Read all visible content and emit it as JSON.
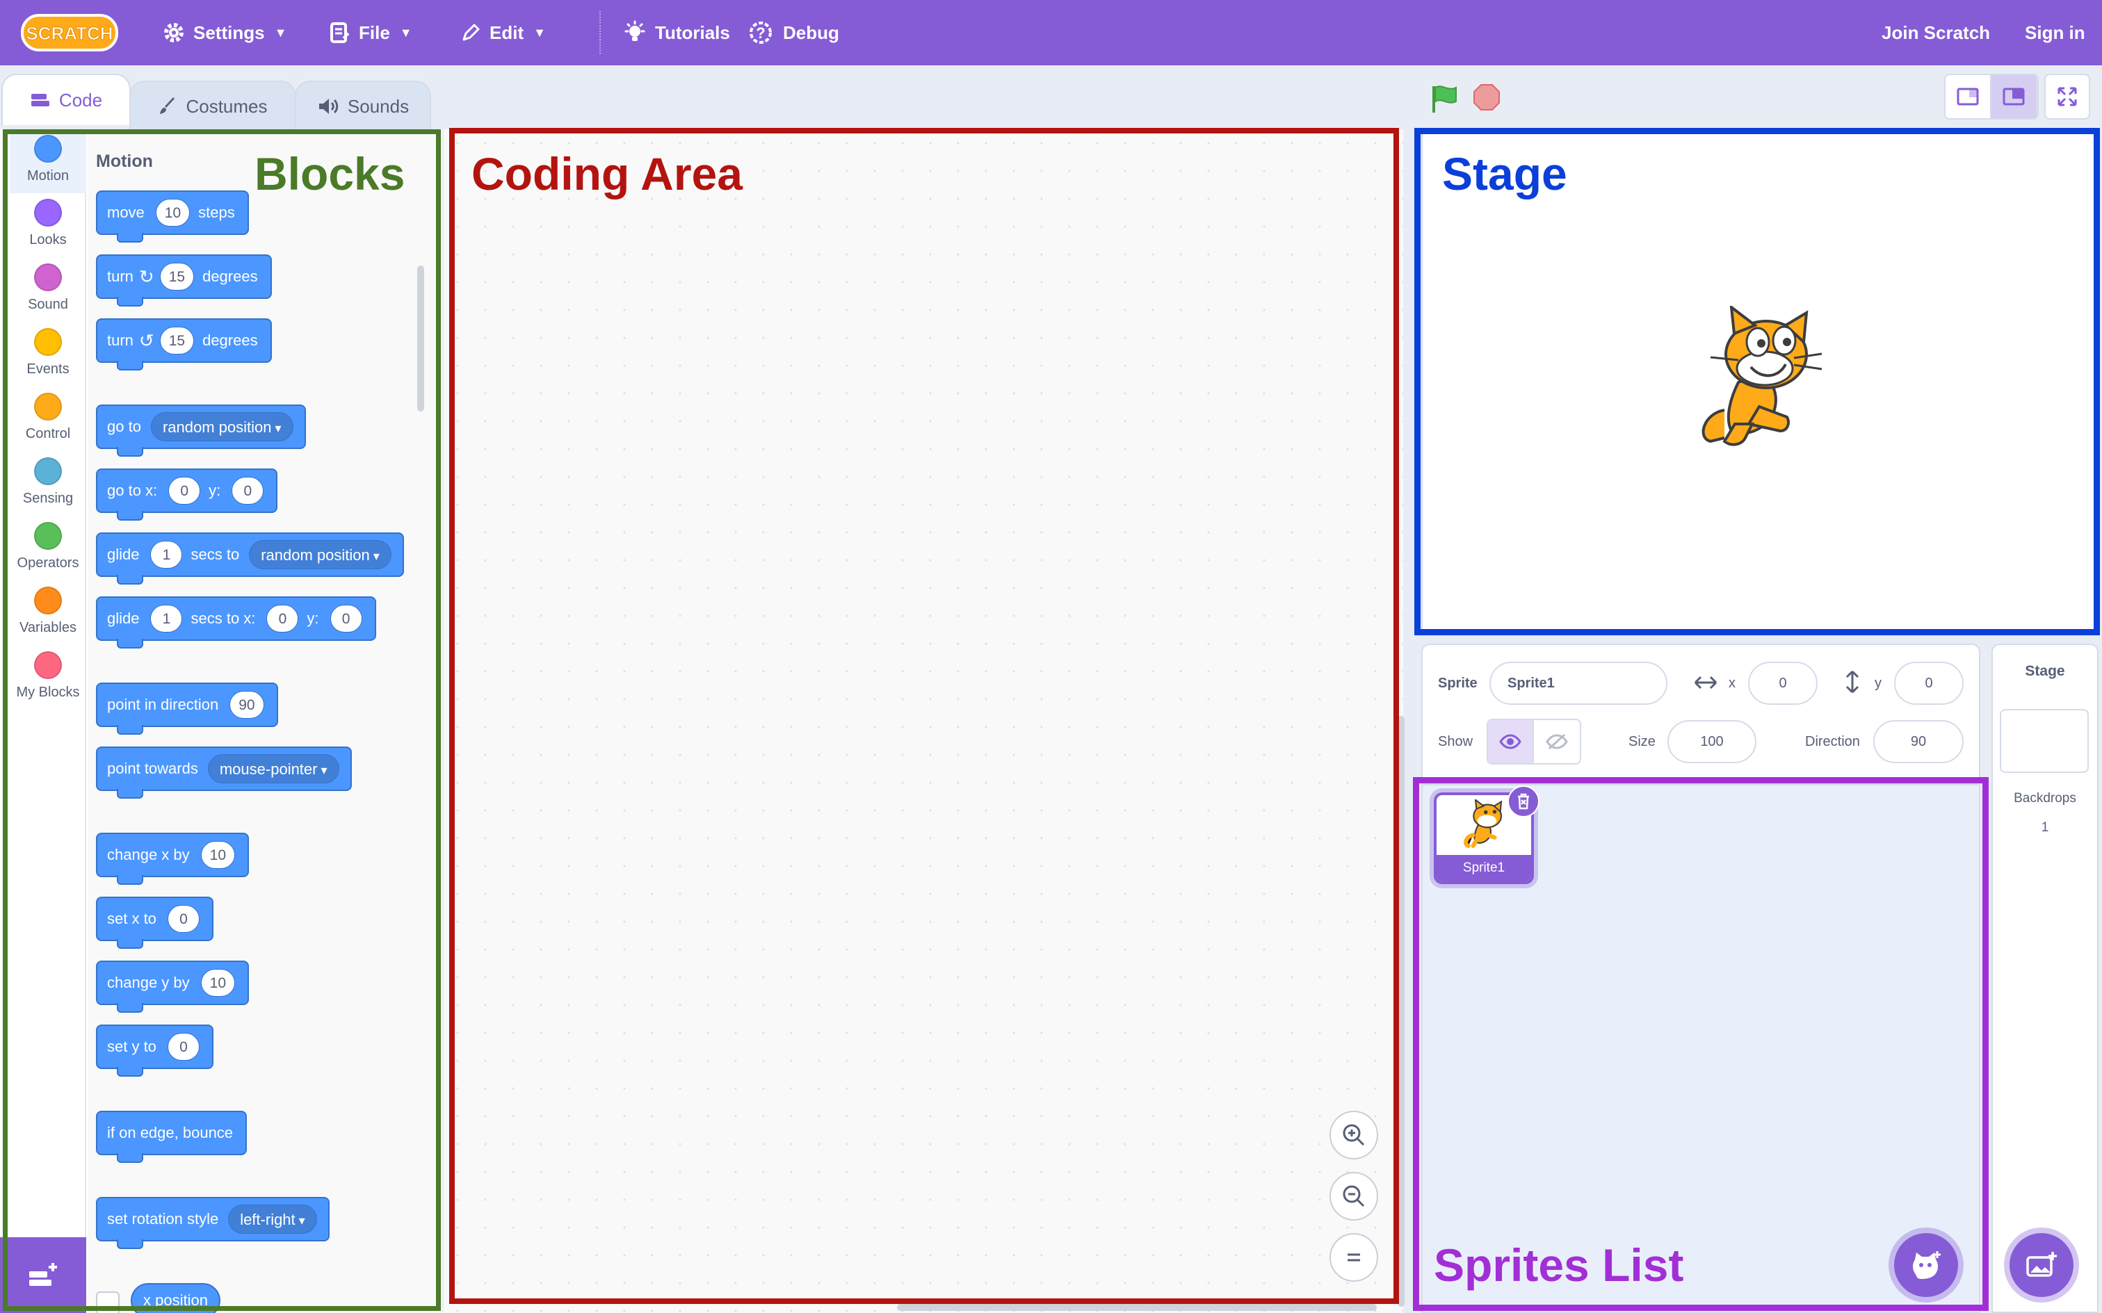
{
  "menubar": {
    "logo_text": "Scratch",
    "settings": "Settings",
    "file": "File",
    "edit": "Edit",
    "tutorials": "Tutorials",
    "debug": "Debug",
    "join": "Join Scratch",
    "signin": "Sign in"
  },
  "tabs": {
    "code": "Code",
    "costumes": "Costumes",
    "sounds": "Sounds"
  },
  "categories": [
    {
      "label": "Motion",
      "color": "#4c97ff"
    },
    {
      "label": "Looks",
      "color": "#9966ff"
    },
    {
      "label": "Sound",
      "color": "#cf63cf"
    },
    {
      "label": "Events",
      "color": "#ffbf00"
    },
    {
      "label": "Control",
      "color": "#ffab19"
    },
    {
      "label": "Sensing",
      "color": "#5cb1d6"
    },
    {
      "label": "Operators",
      "color": "#59c059"
    },
    {
      "label": "Variables",
      "color": "#ff8c1a"
    },
    {
      "label": "My Blocks",
      "color": "#ff6680"
    }
  ],
  "palette": {
    "section": "Motion",
    "move": {
      "a": "move",
      "v": "10",
      "b": "steps"
    },
    "turn_right": {
      "a": "turn",
      "v": "15",
      "b": "degrees"
    },
    "turn_left": {
      "a": "turn",
      "v": "15",
      "b": "degrees"
    },
    "goto": {
      "a": "go to",
      "menu": "random position"
    },
    "gotoxy": {
      "a": "go to x:",
      "x": "0",
      "b": "y:",
      "y": "0"
    },
    "glide_to": {
      "a": "glide",
      "v": "1",
      "b": "secs to",
      "menu": "random position"
    },
    "glide_xy": {
      "a": "glide",
      "v": "1",
      "b": "secs to x:",
      "x": "0",
      "c": "y:",
      "y": "0"
    },
    "point_dir": {
      "a": "point in direction",
      "v": "90"
    },
    "point_towards": {
      "a": "point towards",
      "menu": "mouse-pointer"
    },
    "change_x": {
      "a": "change x by",
      "v": "10"
    },
    "set_x": {
      "a": "set x to",
      "v": "0"
    },
    "change_y": {
      "a": "change y by",
      "v": "10"
    },
    "set_y": {
      "a": "set y to",
      "v": "0"
    },
    "bounce": "if on edge, bounce",
    "rotation": {
      "a": "set rotation style",
      "menu": "left-right"
    },
    "x_position": "x position"
  },
  "sprite_info": {
    "sprite_label": "Sprite",
    "sprite_name": "Sprite1",
    "x_label": "x",
    "x": "0",
    "y_label": "y",
    "y": "0",
    "show_label": "Show",
    "size_label": "Size",
    "size": "100",
    "direction_label": "Direction",
    "direction": "90"
  },
  "sprites": [
    {
      "name": "Sprite1"
    }
  ],
  "stage_pane": {
    "title": "Stage",
    "backdrops_label": "Backdrops",
    "backdrops_count": "1"
  },
  "annotations": {
    "blocks": {
      "label": "Blocks",
      "color": "#4b7a28"
    },
    "coding": {
      "label": "Coding Area",
      "color": "#b3140f"
    },
    "stage": {
      "label": "Stage",
      "color": "#0b3fd9"
    },
    "sprites": {
      "label": "Sprites List",
      "color": "#a22fd6"
    }
  },
  "colors": {
    "accent": "#855cd6",
    "motion": "#4c97ff"
  }
}
